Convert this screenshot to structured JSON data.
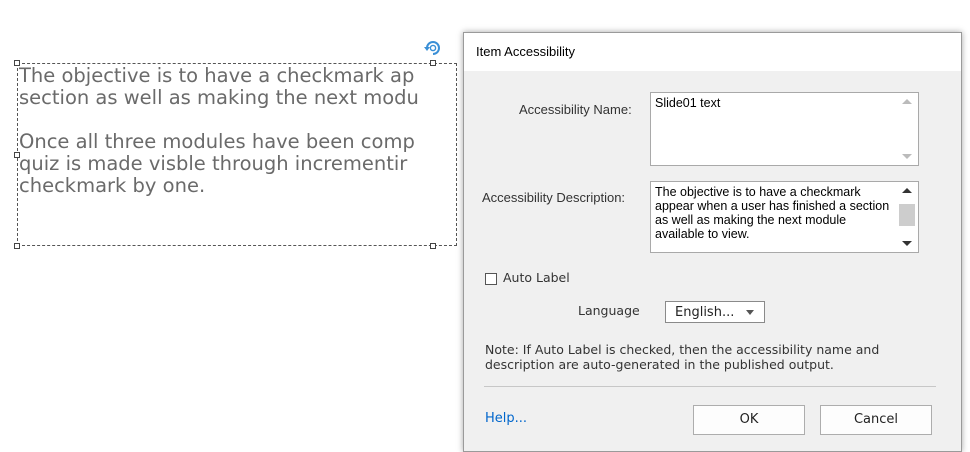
{
  "slide": {
    "paragraph1_line1": "The objective is to have a checkmark ap",
    "paragraph1_line2": "section as well as making the next modu",
    "paragraph2_line1": "Once all three modules have been comp",
    "paragraph2_line2": "quiz is made visble through incrementir",
    "paragraph2_line3": "checkmark by one."
  },
  "dialog": {
    "title": "Item Accessibility",
    "name_label": "Accessibility Name:",
    "name_value": "Slide01 text",
    "description_label": "Accessibility Description:",
    "description_value": "The objective is to have a checkmark appear when a user has finished a section as well as making the next module available to view.",
    "auto_label": "Auto Label",
    "auto_label_checked": false,
    "language_label": "Language",
    "language_value": "English...",
    "note": "Note: If Auto Label is checked, then the accessibility name and description are auto-generated in the published output.",
    "help_link": "Help...",
    "ok_button": "OK",
    "cancel_button": "Cancel"
  },
  "colors": {
    "slide_text": "#6a6a6a",
    "rotate_icon": "#3a8fd6",
    "link": "#0066cc",
    "dialog_bg": "#f0f0f0"
  },
  "icons": {
    "rotate": "rotate-handle-icon",
    "checkbox": "checkbox-icon",
    "dropdown": "chevron-down-icon"
  }
}
